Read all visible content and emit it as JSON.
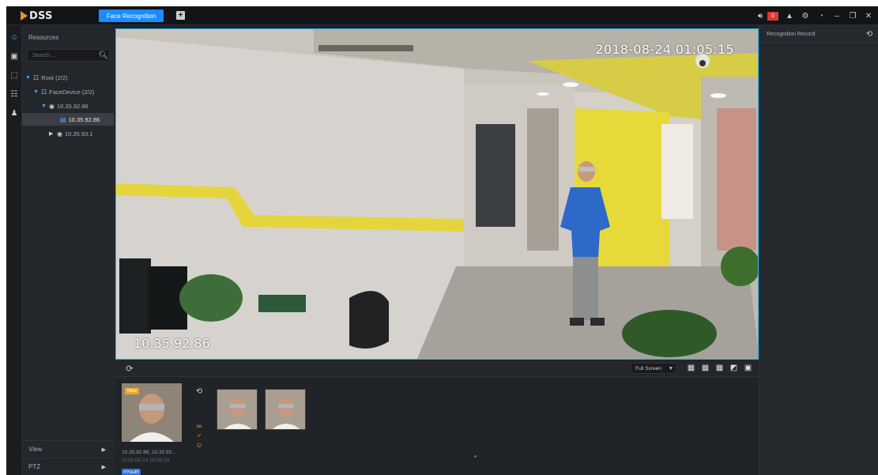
{
  "app": {
    "logo": "DSS",
    "module_tab": "Face Recognition",
    "add_tab_symbol": "+",
    "alarm_count": "0",
    "accent_color": "#1a8cff",
    "highlight_color": "#29b6f6"
  },
  "topbar_icons": [
    "speaker-icon",
    "user-icon",
    "settings-icon",
    "gauge-icon",
    "minimize-icon",
    "restore-icon",
    "close-icon"
  ],
  "rail_icons": [
    "face-monitor-icon",
    "face-search-icon",
    "face-capture-icon",
    "report-icon",
    "people-icon"
  ],
  "resources": {
    "title": "Resources",
    "search_placeholder": "Search...",
    "tree": {
      "root": "Root (2/2)",
      "device_group": "FaceDevice (2/2)",
      "device_1": "10.35.92.86",
      "channel_selected": "10.35.92.86",
      "device_2": "10.35.93.1"
    },
    "bottom_tabs": [
      "View",
      "PTZ"
    ]
  },
  "video": {
    "timestamp": "2018-08-24 01:05:15",
    "channel_label": "10.35.92.86"
  },
  "toolbar": {
    "display_mode": "Full Screen",
    "layout_icons": [
      "layout-4-icon",
      "layout-6-icon",
      "layout-9-icon",
      "custom-layout-icon",
      "fullscreen-icon"
    ]
  },
  "capture": {
    "new_tag": "New",
    "title": "10.35.92.86, 10.35.92...",
    "time": "2018-08-24 16:05:04",
    "age_tag": "#Youth",
    "attribute_icons": [
      "glasses-icon",
      "male-icon",
      "smile-icon"
    ]
  },
  "recognition": {
    "title": "Recognition Record"
  }
}
